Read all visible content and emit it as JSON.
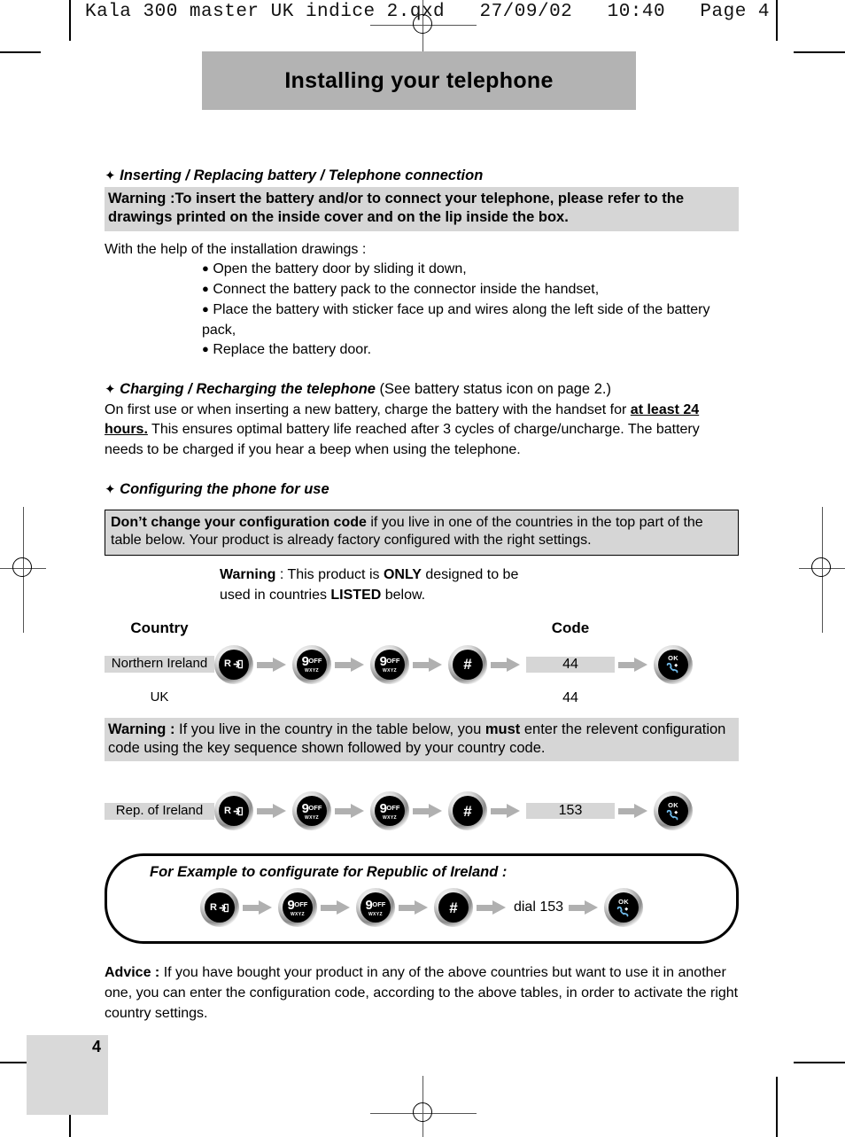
{
  "file_header": "Kala 300 master UK indice 2.qxd   27/09/02   10:40   Page 4",
  "page_title": "Installing your telephone",
  "sections": {
    "battery": {
      "heading_marker": "✦",
      "heading": "Inserting / Replacing battery / Telephone connection",
      "warning": "Warning :To insert the battery and/or to connect your telephone, please refer to the drawings printed on the inside cover and on the lip inside the box.",
      "intro": "With the help of the installation drawings :",
      "bullets": [
        "Open the battery door by sliding it down,",
        "Connect the battery pack to the connector inside the handset,",
        "Place the battery with sticker face up and wires along the left side of the battery pack,",
        "Replace the battery door."
      ]
    },
    "charging": {
      "heading": "Charging / Recharging the telephone",
      "heading_note": "(See battery status icon on page 2.)",
      "body_1": "On first use or when inserting a new battery, charge the battery with the handset for ",
      "emphasis": "at least 24 hours.",
      "body_2": " This ensures optimal battery life reached after 3 cycles of charge/uncharge. The battery needs to be charged if you hear a beep when using the telephone."
    },
    "configuring": {
      "heading": "Configuring the phone for use",
      "dont_change_bold": "Don’t change your configuration code",
      "dont_change_rest": " if you live in one of the countries in the top part of the table below. Your product is already factory configured with the right settings.",
      "warning_only_line1_a": "Warning",
      "warning_only_line1_b": " : This product is ",
      "warning_only_line1_c": "ONLY",
      "warning_only_line1_d": " designed to be",
      "warning_only_line2_a": "used in countries ",
      "warning_only_line2_b": "LISTED",
      "warning_only_line2_c": " below."
    }
  },
  "table": {
    "col_country": "Country",
    "col_code": "Code",
    "rows": [
      {
        "country": "Northern Ireland",
        "code": "44",
        "shaded": true
      },
      {
        "country": "UK",
        "code": "44",
        "shaded": false
      }
    ]
  },
  "warning_must": {
    "bold_lead": "Warning :",
    "text_a": " If you live in the country in the table below, you ",
    "bold_must": "must",
    "text_b": " enter the relevent configuration code using the key sequence shown followed by your country code."
  },
  "second_table": {
    "country": "Rep. of Ireland",
    "code": "153"
  },
  "key_sequence": {
    "r_key_label": "R",
    "nine_key_label": "9",
    "nine_key_off": "OFF",
    "nine_key_sub": "WXYZ",
    "hash_key_label": "#",
    "ok_key_label": "OK"
  },
  "example": {
    "title": "For Example to configurate for Republic of Ireland :",
    "dial_text": "dial 153"
  },
  "advice": {
    "bold_lead": "Advice :",
    "text": " If you have bought your product in any of the above countries but want to use it in another one, you can enter the configuration code, according to the above tables, in order to activate the right country settings."
  },
  "footer": {
    "page_number": "4"
  },
  "colors": {
    "banner_gray": "#b3b3b3",
    "band_gray": "#d6d6d6",
    "arrow_gray": "#b0b0b0",
    "footer_gray": "#d9d9d9"
  }
}
